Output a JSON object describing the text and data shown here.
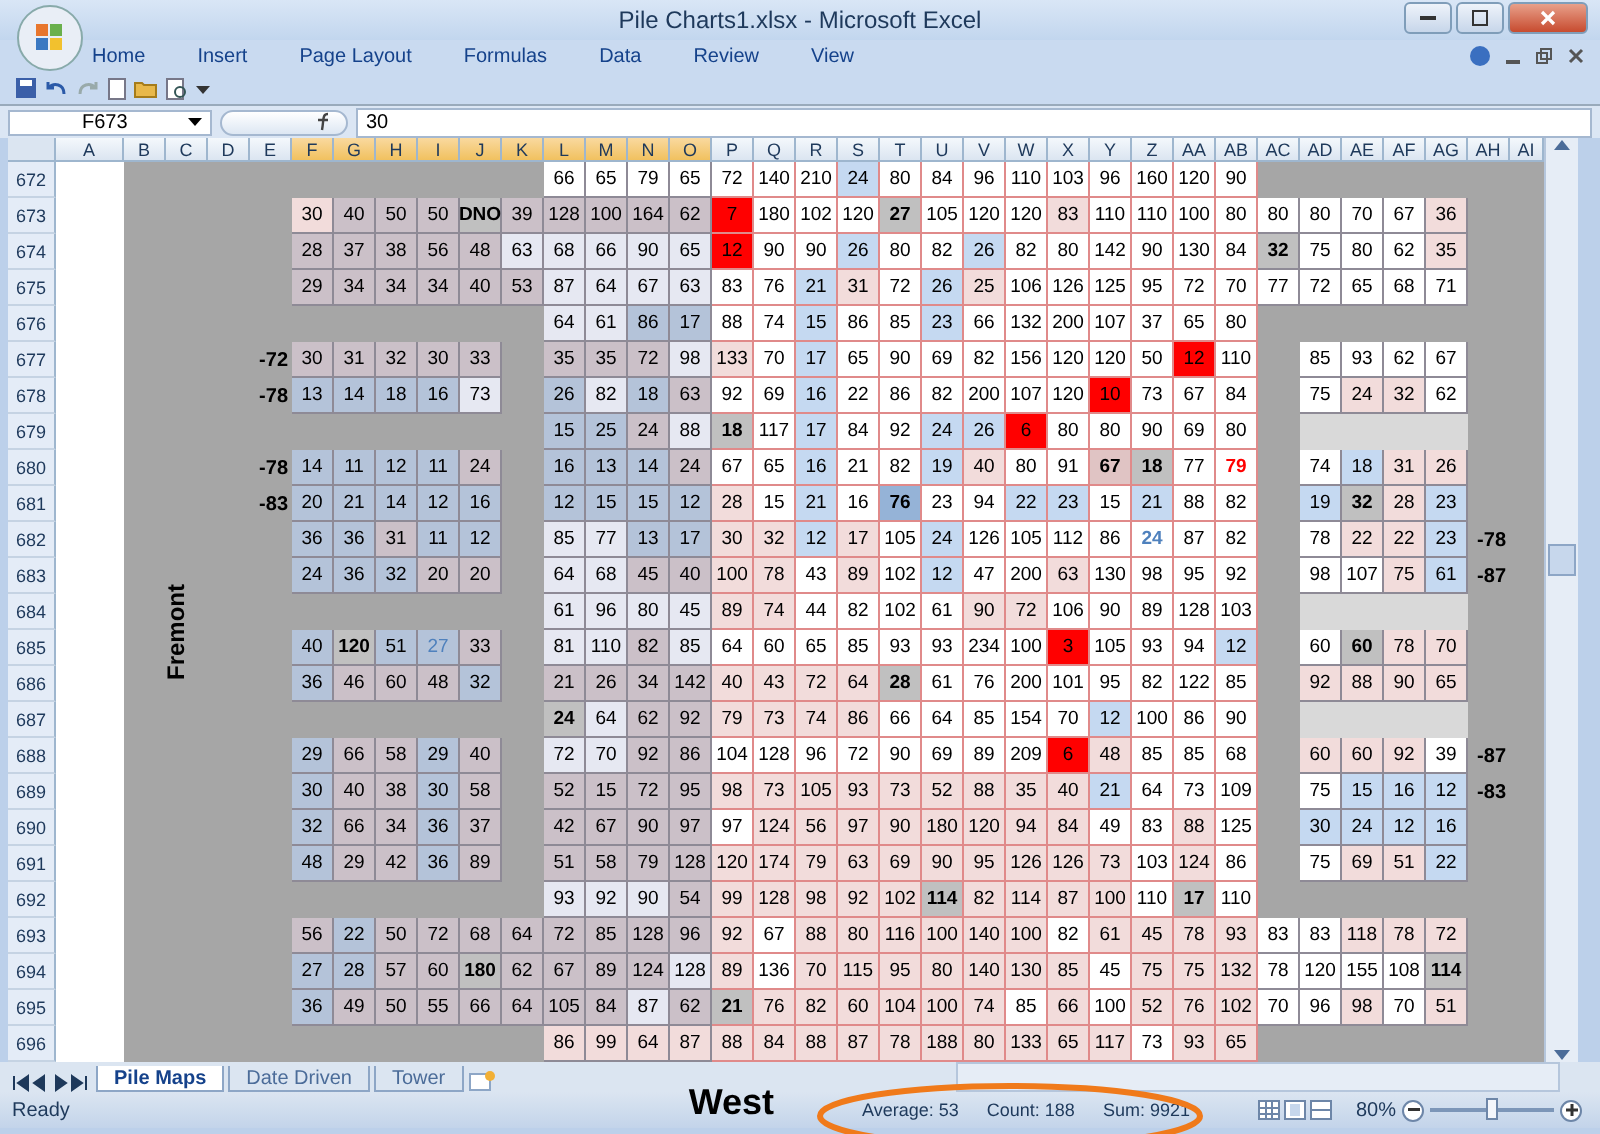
{
  "window": {
    "title": "Pile Charts1.xlsx - Microsoft Excel"
  },
  "ribbon_tabs": [
    "Home",
    "Insert",
    "Page Layout",
    "Formulas",
    "Data",
    "Review",
    "View"
  ],
  "name_box": "F673",
  "formula": "30",
  "columns": [
    {
      "label": "A",
      "selected": false
    },
    {
      "label": "B",
      "selected": false
    },
    {
      "label": "C",
      "selected": false
    },
    {
      "label": "D",
      "selected": false
    },
    {
      "label": "E",
      "selected": false
    },
    {
      "label": "F",
      "selected": true
    },
    {
      "label": "G",
      "selected": true
    },
    {
      "label": "H",
      "selected": true
    },
    {
      "label": "I",
      "selected": true
    },
    {
      "label": "J",
      "selected": true
    },
    {
      "label": "K",
      "selected": true
    },
    {
      "label": "L",
      "selected": true
    },
    {
      "label": "M",
      "selected": true
    },
    {
      "label": "N",
      "selected": true
    },
    {
      "label": "O",
      "selected": true
    },
    {
      "label": "P",
      "selected": false
    },
    {
      "label": "Q",
      "selected": false
    },
    {
      "label": "R",
      "selected": false
    },
    {
      "label": "S",
      "selected": false
    },
    {
      "label": "T",
      "selected": false
    },
    {
      "label": "U",
      "selected": false
    },
    {
      "label": "V",
      "selected": false
    },
    {
      "label": "W",
      "selected": false
    },
    {
      "label": "X",
      "selected": false
    },
    {
      "label": "Y",
      "selected": false
    },
    {
      "label": "Z",
      "selected": false
    },
    {
      "label": "AA",
      "selected": false
    },
    {
      "label": "AB",
      "selected": false
    },
    {
      "label": "AC",
      "selected": false
    },
    {
      "label": "AD",
      "selected": false
    },
    {
      "label": "AE",
      "selected": false
    },
    {
      "label": "AF",
      "selected": false
    },
    {
      "label": "AG",
      "selected": false
    },
    {
      "label": "AH",
      "selected": false
    },
    {
      "label": "AI",
      "selected": false
    }
  ],
  "rows": [
    {
      "number": "672",
      "cells": [
        null,
        null,
        null,
        null,
        null,
        null,
        "66",
        "65",
        "79",
        "65",
        "72",
        "140",
        "210",
        {
          "text": "24",
          "color": "#c5d9f1"
        },
        "80",
        "84",
        "96",
        "110",
        "103",
        "96",
        "160",
        "120",
        "90",
        null,
        null,
        null,
        null,
        null
      ]
    },
    {
      "number": "673",
      "cells": [
        {
          "text": "30",
          "color": "#f2dcdb"
        },
        {
          "text": "40",
          "color": "#cbc0c8"
        },
        {
          "text": "50",
          "color": "#cbc0c8"
        },
        {
          "text": "50",
          "color": "#cbc0c8"
        },
        {
          "text": "DNO",
          "color": "#c0c0c0",
          "bold": true
        },
        {
          "text": "39",
          "color": "#cbc0c8"
        },
        {
          "text": "128",
          "color": "#cbc0c8"
        },
        {
          "text": "100",
          "color": "#cbc0c8"
        },
        {
          "text": "164",
          "color": "#cbc0c8"
        },
        {
          "text": "62",
          "color": "#cbc0c8"
        },
        {
          "text": "7",
          "color": "#ff0000"
        },
        "180",
        "102",
        "120",
        {
          "text": "27",
          "color": "#c0c0c0",
          "bold": true
        },
        "105",
        "120",
        "120",
        {
          "text": "83",
          "color": "#f2dcdb"
        },
        "110",
        "110",
        "100",
        "80",
        "80",
        "80",
        "70",
        "67",
        {
          "text": "36",
          "color": "#f2dcdb"
        }
      ]
    },
    {
      "number": "674",
      "cells": [
        {
          "text": "28",
          "color": "#cbc0c8"
        },
        {
          "text": "37",
          "color": "#cbc0c8"
        },
        {
          "text": "38",
          "color": "#cbc0c8"
        },
        {
          "text": "56",
          "color": "#cbc0c8"
        },
        {
          "text": "48",
          "color": "#cbc0c8"
        },
        {
          "text": "63",
          "color": "#e6e8f2"
        },
        {
          "text": "68",
          "color": "#e6e8f2"
        },
        {
          "text": "66",
          "color": "#e6e8f2"
        },
        {
          "text": "90",
          "color": "#e6e8f2"
        },
        {
          "text": "65",
          "color": "#e6e8f2"
        },
        {
          "text": "12",
          "color": "#ff0000"
        },
        "90",
        "90",
        {
          "text": "26",
          "color": "#c5d9f1"
        },
        "80",
        "82",
        {
          "text": "26",
          "color": "#c5d9f1"
        },
        "82",
        "80",
        "142",
        "90",
        "130",
        "84",
        {
          "text": "32",
          "color": "#c0c0c0",
          "bold": true
        },
        "75",
        "80",
        "62",
        {
          "text": "35",
          "color": "#f2dcdb"
        }
      ]
    },
    {
      "number": "675",
      "cells": [
        {
          "text": "29",
          "color": "#cbc0c8"
        },
        {
          "text": "34",
          "color": "#cbc0c8"
        },
        {
          "text": "34",
          "color": "#cbc0c8"
        },
        {
          "text": "34",
          "color": "#cbc0c8"
        },
        {
          "text": "40",
          "color": "#cbc0c8"
        },
        {
          "text": "53",
          "color": "#cbc0c8"
        },
        {
          "text": "87",
          "color": "#e6e8f2"
        },
        {
          "text": "64",
          "color": "#e6e8f2"
        },
        {
          "text": "67",
          "color": "#e6e8f2"
        },
        {
          "text": "63",
          "color": "#e6e8f2"
        },
        "83",
        "76",
        {
          "text": "21",
          "color": "#c5d9f1"
        },
        {
          "text": "31",
          "color": "#f2dcdb"
        },
        "72",
        {
          "text": "26",
          "color": "#c5d9f1"
        },
        {
          "text": "25",
          "color": "#f2dcdb"
        },
        "106",
        "126",
        "125",
        "95",
        "72",
        "70",
        "77",
        "72",
        "65",
        "68",
        "71"
      ]
    },
    {
      "number": "676",
      "cells": [
        null,
        null,
        null,
        null,
        null,
        null,
        {
          "text": "64",
          "color": "#e6e8f2"
        },
        {
          "text": "61",
          "color": "#e6e8f2"
        },
        {
          "text": "86",
          "color": "#b4c3d9"
        },
        {
          "text": "17",
          "color": "#b4c3d9"
        },
        "88",
        "74",
        {
          "text": "15",
          "color": "#c5d9f1"
        },
        "86",
        "85",
        {
          "text": "23",
          "color": "#c5d9f1"
        },
        "66",
        "132",
        "200",
        "107",
        "37",
        "65",
        "80",
        null,
        null,
        null,
        null,
        null
      ]
    },
    {
      "number": "677",
      "left_label": "-72",
      "cells": [
        {
          "text": "30",
          "color": "#cbc0c8"
        },
        {
          "text": "31",
          "color": "#cbc0c8"
        },
        {
          "text": "32",
          "color": "#cbc0c8"
        },
        {
          "text": "30",
          "color": "#cbc0c8"
        },
        {
          "text": "33",
          "color": "#cbc0c8"
        },
        null,
        {
          "text": "35",
          "color": "#cbc0c8"
        },
        {
          "text": "35",
          "color": "#cbc0c8"
        },
        {
          "text": "72",
          "color": "#cbc0c8"
        },
        {
          "text": "98",
          "color": "#e6e8f2"
        },
        {
          "text": "133",
          "color": "#f2dcdb"
        },
        "70",
        {
          "text": "17",
          "color": "#c5d9f1"
        },
        "65",
        "90",
        "69",
        "82",
        "156",
        "120",
        "120",
        "50",
        {
          "text": "12",
          "color": "#ff0000"
        },
        "110",
        null,
        "85",
        "93",
        "62",
        "67"
      ]
    },
    {
      "number": "678",
      "left_label": "-78",
      "cells": [
        {
          "text": "13",
          "color": "#b4c3d9"
        },
        {
          "text": "14",
          "color": "#b4c3d9"
        },
        {
          "text": "18",
          "color": "#b4c3d9"
        },
        {
          "text": "16",
          "color": "#b4c3d9"
        },
        {
          "text": "73",
          "color": "#e6e8f2"
        },
        null,
        {
          "text": "26",
          "color": "#b4c3d9"
        },
        {
          "text": "82",
          "color": "#e6e8f2"
        },
        {
          "text": "18",
          "color": "#b4c3d9"
        },
        {
          "text": "63",
          "color": "#cbc0c8"
        },
        "92",
        "69",
        {
          "text": "16",
          "color": "#c5d9f1"
        },
        "22",
        "86",
        "82",
        "200",
        "107",
        "120",
        {
          "text": "10",
          "color": "#ff0000"
        },
        "73",
        "67",
        "84",
        null,
        "75",
        {
          "text": "24",
          "color": "#f2dcdb"
        },
        {
          "text": "32",
          "color": "#f2dcdb"
        },
        "62"
      ]
    },
    {
      "number": "679",
      "cells": [
        null,
        null,
        null,
        null,
        null,
        null,
        {
          "text": "15",
          "color": "#b4c3d9"
        },
        {
          "text": "25",
          "color": "#b4c3d9"
        },
        {
          "text": "24",
          "color": "#cbc0c8"
        },
        {
          "text": "88",
          "color": "#e6e8f2"
        },
        {
          "text": "18",
          "color": "#c0c0c0",
          "bold": true
        },
        "117",
        {
          "text": "17",
          "color": "#c5d9f1"
        },
        "84",
        "92",
        {
          "text": "24",
          "color": "#c5d9f1"
        },
        {
          "text": "26",
          "color": "#c5d9f1"
        },
        {
          "text": "6",
          "color": "#ff0000"
        },
        "80",
        "80",
        "90",
        "69",
        "80",
        null,
        {
          "color": "#d9d9d9"
        },
        {
          "color": "#d9d9d9"
        },
        {
          "color": "#d9d9d9"
        },
        {
          "color": "#d9d9d9"
        }
      ]
    },
    {
      "number": "680",
      "left_label": "-78",
      "cells": [
        {
          "text": "14",
          "color": "#b4c3d9"
        },
        {
          "text": "11",
          "color": "#b4c3d9"
        },
        {
          "text": "12",
          "color": "#b4c3d9"
        },
        {
          "text": "11",
          "color": "#b4c3d9"
        },
        {
          "text": "24",
          "color": "#cbc0c8"
        },
        null,
        {
          "text": "16",
          "color": "#b4c3d9"
        },
        {
          "text": "13",
          "color": "#b4c3d9"
        },
        {
          "text": "14",
          "color": "#b4c3d9"
        },
        {
          "text": "24",
          "color": "#cbc0c8"
        },
        "67",
        "65",
        {
          "text": "16",
          "color": "#c5d9f1"
        },
        "21",
        "82",
        {
          "text": "19",
          "color": "#c5d9f1"
        },
        {
          "text": "40",
          "color": "#f2dcdb"
        },
        "80",
        "91",
        {
          "text": "67",
          "color": "#e0c4c4",
          "bold": true
        },
        {
          "text": "18",
          "color": "#c0c0c0",
          "bold": true
        },
        "77",
        {
          "text": "79",
          "color": "#ffffff",
          "bold": true,
          "kind": "warning"
        },
        null,
        "74",
        {
          "text": "18",
          "color": "#c5d9f1"
        },
        {
          "text": "31",
          "color": "#f2dcdb"
        },
        {
          "text": "26",
          "color": "#f2dcdb"
        }
      ]
    },
    {
      "number": "681",
      "left_label": "-83",
      "cells": [
        {
          "text": "20",
          "color": "#b4c3d9"
        },
        {
          "text": "21",
          "color": "#b4c3d9"
        },
        {
          "text": "14",
          "color": "#b4c3d9"
        },
        {
          "text": "12",
          "color": "#b4c3d9"
        },
        {
          "text": "16",
          "color": "#b4c3d9"
        },
        null,
        {
          "text": "12",
          "color": "#b4c3d9"
        },
        {
          "text": "15",
          "color": "#b4c3d9"
        },
        {
          "text": "15",
          "color": "#b4c3d9"
        },
        {
          "text": "12",
          "color": "#b4c3d9"
        },
        {
          "text": "28",
          "color": "#f2dcdb"
        },
        "15",
        {
          "text": "21",
          "color": "#c5d9f1"
        },
        "16",
        {
          "text": "76",
          "color": "#95b3d7",
          "bold": true
        },
        "23",
        "94",
        {
          "text": "22",
          "color": "#c5d9f1"
        },
        {
          "text": "23",
          "color": "#c5d9f1"
        },
        "15",
        {
          "text": "21",
          "color": "#c5d9f1"
        },
        "88",
        "82",
        null,
        {
          "text": "19",
          "color": "#c5d9f1"
        },
        {
          "text": "32",
          "color": "#c0c0c0",
          "bold": true
        },
        {
          "text": "28",
          "color": "#f2dcdb"
        },
        {
          "text": "23",
          "color": "#c5d9f1"
        }
      ]
    },
    {
      "number": "682",
      "right_label": "-78",
      "cells": [
        {
          "text": "36",
          "color": "#b4c3d9"
        },
        {
          "text": "36",
          "color": "#b4c3d9"
        },
        {
          "text": "31",
          "color": "#cbc0c8"
        },
        {
          "text": "11",
          "color": "#b4c3d9"
        },
        {
          "text": "12",
          "color": "#b4c3d9"
        },
        null,
        {
          "text": "85",
          "color": "#e6e8f2"
        },
        {
          "text": "77",
          "color": "#e6e8f2"
        },
        {
          "text": "13",
          "color": "#b4c3d9"
        },
        {
          "text": "17",
          "color": "#b4c3d9"
        },
        {
          "text": "30",
          "color": "#f2dcdb"
        },
        {
          "text": "32",
          "color": "#f2dcdb"
        },
        {
          "text": "12",
          "color": "#c5d9f1"
        },
        {
          "text": "17",
          "color": "#f2dcdb"
        },
        "105",
        {
          "text": "24",
          "color": "#c5d9f1"
        },
        "126",
        "105",
        "112",
        "86",
        {
          "text": "24",
          "color": "#ffffff",
          "bold": true,
          "kind": "note"
        },
        "87",
        "82",
        null,
        "78",
        {
          "text": "22",
          "color": "#f2dcdb"
        },
        {
          "text": "22",
          "color": "#f2dcdb"
        },
        {
          "text": "23",
          "color": "#c5d9f1"
        }
      ]
    },
    {
      "number": "683",
      "right_label": "-87",
      "cells": [
        {
          "text": "24",
          "color": "#b4c3d9"
        },
        {
          "text": "36",
          "color": "#b4c3d9"
        },
        {
          "text": "32",
          "color": "#b4c3d9"
        },
        {
          "text": "20",
          "color": "#cbc0c8"
        },
        {
          "text": "20",
          "color": "#cbc0c8"
        },
        null,
        {
          "text": "64",
          "color": "#e6e8f2"
        },
        {
          "text": "68",
          "color": "#e6e8f2"
        },
        {
          "text": "45",
          "color": "#cbc0c8"
        },
        {
          "text": "40",
          "color": "#cbc0c8"
        },
        {
          "text": "100",
          "color": "#f2dcdb"
        },
        {
          "text": "78",
          "color": "#f2dcdb"
        },
        "43",
        {
          "text": "89",
          "color": "#f2dcdb"
        },
        "102",
        {
          "text": "12",
          "color": "#c5d9f1"
        },
        "47",
        "200",
        {
          "text": "63",
          "color": "#f2dcdb"
        },
        "130",
        "98",
        "95",
        "92",
        null,
        "98",
        "107",
        {
          "text": "75",
          "color": "#f2dcdb"
        },
        {
          "text": "61",
          "color": "#c5d9f1"
        }
      ]
    },
    {
      "number": "684",
      "cells": [
        null,
        null,
        null,
        null,
        null,
        null,
        {
          "text": "61",
          "color": "#e6e8f2"
        },
        {
          "text": "96",
          "color": "#e6e8f2"
        },
        {
          "text": "80",
          "color": "#e6e8f2"
        },
        {
          "text": "45",
          "color": "#e6e8f2"
        },
        {
          "text": "89",
          "color": "#f2dcdb"
        },
        {
          "text": "74",
          "color": "#f2dcdb"
        },
        "44",
        "82",
        "102",
        "61",
        {
          "text": "90",
          "color": "#f2dcdb"
        },
        {
          "text": "72",
          "color": "#f2dcdb"
        },
        "106",
        "90",
        "89",
        "128",
        "103",
        null,
        {
          "color": "#d9d9d9"
        },
        {
          "color": "#d9d9d9"
        },
        {
          "color": "#d9d9d9"
        },
        {
          "color": "#d9d9d9"
        }
      ]
    },
    {
      "number": "685",
      "cells": [
        {
          "text": "40",
          "color": "#b4c3d9"
        },
        {
          "text": "120",
          "color": "#c0c0c0",
          "bold": true
        },
        {
          "text": "51",
          "color": "#b4c3d9"
        },
        {
          "text": "27",
          "color": "#b4c3d9",
          "kind": "note"
        },
        {
          "text": "33",
          "color": "#cbc0c8"
        },
        null,
        {
          "text": "81",
          "color": "#e6e8f2"
        },
        {
          "text": "110",
          "color": "#e6e8f2"
        },
        {
          "text": "82",
          "color": "#cbc0c8"
        },
        {
          "text": "85",
          "color": "#e6e8f2"
        },
        "64",
        "60",
        "65",
        "85",
        "93",
        "93",
        "234",
        "100",
        {
          "text": "3",
          "color": "#ff0000"
        },
        "105",
        "93",
        "94",
        {
          "text": "12",
          "color": "#c5d9f1"
        },
        null,
        "60",
        {
          "text": "60",
          "color": "#c0c0c0",
          "bold": true
        },
        {
          "text": "78",
          "color": "#f2dcdb"
        },
        {
          "text": "70",
          "color": "#f2dcdb"
        }
      ]
    },
    {
      "number": "686",
      "cells": [
        {
          "text": "36",
          "color": "#b4c3d9"
        },
        {
          "text": "46",
          "color": "#cbc0c8"
        },
        {
          "text": "60",
          "color": "#cbc0c8"
        },
        {
          "text": "48",
          "color": "#cbc0c8"
        },
        {
          "text": "32",
          "color": "#b4c3d9"
        },
        null,
        {
          "text": "21",
          "color": "#cbc0c8"
        },
        {
          "text": "26",
          "color": "#cbc0c8"
        },
        {
          "text": "34",
          "color": "#cbc0c8"
        },
        {
          "text": "142",
          "color": "#cbc0c8"
        },
        {
          "text": "40",
          "color": "#f2dcdb"
        },
        {
          "text": "43",
          "color": "#f2dcdb"
        },
        {
          "text": "72",
          "color": "#f2dcdb"
        },
        {
          "text": "64",
          "color": "#f2dcdb"
        },
        {
          "text": "28",
          "color": "#c0c0c0",
          "bold": true
        },
        "61",
        "76",
        "200",
        "101",
        "95",
        "82",
        "122",
        "85",
        null,
        {
          "text": "92",
          "color": "#f2dcdb"
        },
        {
          "text": "88",
          "color": "#f2dcdb"
        },
        {
          "text": "90",
          "color": "#f2dcdb"
        },
        {
          "text": "65",
          "color": "#f2dcdb"
        }
      ]
    },
    {
      "number": "687",
      "cells": [
        null,
        null,
        null,
        null,
        null,
        null,
        {
          "text": "24",
          "color": "#c0c0c0",
          "bold": true
        },
        {
          "text": "64",
          "color": "#e6e8f2"
        },
        {
          "text": "62",
          "color": "#cbc0c8"
        },
        {
          "text": "92",
          "color": "#cbc0c8"
        },
        {
          "text": "79",
          "color": "#f2dcdb"
        },
        {
          "text": "73",
          "color": "#f2dcdb"
        },
        {
          "text": "74",
          "color": "#f2dcdb"
        },
        {
          "text": "86",
          "color": "#f2dcdb"
        },
        "66",
        "64",
        "85",
        "154",
        "70",
        {
          "text": "12",
          "color": "#c5d9f1"
        },
        "100",
        "86",
        "90",
        null,
        {
          "color": "#d9d9d9"
        },
        {
          "color": "#d9d9d9"
        },
        {
          "color": "#d9d9d9"
        },
        {
          "color": "#d9d9d9"
        }
      ]
    },
    {
      "number": "688",
      "right_label": "-87",
      "cells": [
        {
          "text": "29",
          "color": "#b4c3d9"
        },
        {
          "text": "66",
          "color": "#cbc0c8"
        },
        {
          "text": "58",
          "color": "#cbc0c8"
        },
        {
          "text": "29",
          "color": "#b4c3d9"
        },
        {
          "text": "40",
          "color": "#cbc0c8"
        },
        null,
        {
          "text": "72",
          "color": "#e6e8f2"
        },
        {
          "text": "70",
          "color": "#e6e8f2"
        },
        {
          "text": "92",
          "color": "#cbc0c8"
        },
        {
          "text": "86",
          "color": "#cbc0c8"
        },
        "104",
        "128",
        "96",
        "72",
        "90",
        "69",
        "89",
        "209",
        {
          "text": "6",
          "color": "#ff0000"
        },
        {
          "text": "48",
          "color": "#f2dcdb"
        },
        "85",
        "85",
        "68",
        null,
        {
          "text": "60",
          "color": "#f2dcdb"
        },
        {
          "text": "60",
          "color": "#f2dcdb"
        },
        {
          "text": "92",
          "color": "#f2dcdb"
        },
        "39"
      ]
    },
    {
      "number": "689",
      "right_label": "-83",
      "cells": [
        {
          "text": "30",
          "color": "#b4c3d9"
        },
        {
          "text": "40",
          "color": "#cbc0c8"
        },
        {
          "text": "38",
          "color": "#cbc0c8"
        },
        {
          "text": "30",
          "color": "#b4c3d9"
        },
        {
          "text": "58",
          "color": "#cbc0c8"
        },
        null,
        {
          "text": "52",
          "color": "#cbc0c8"
        },
        {
          "text": "15",
          "color": "#cbc0c8"
        },
        {
          "text": "72",
          "color": "#cbc0c8"
        },
        {
          "text": "95",
          "color": "#cbc0c8"
        },
        {
          "text": "98",
          "color": "#f2dcdb"
        },
        {
          "text": "73",
          "color": "#f2dcdb"
        },
        {
          "text": "105",
          "color": "#f2dcdb"
        },
        {
          "text": "93",
          "color": "#f2dcdb"
        },
        {
          "text": "73",
          "color": "#f2dcdb"
        },
        {
          "text": "52",
          "color": "#f2dcdb"
        },
        {
          "text": "88",
          "color": "#f2dcdb"
        },
        {
          "text": "35",
          "color": "#f2dcdb"
        },
        {
          "text": "40",
          "color": "#f2dcdb"
        },
        {
          "text": "21",
          "color": "#c5d9f1"
        },
        "64",
        "73",
        "109",
        null,
        "75",
        {
          "text": "15",
          "color": "#c5d9f1"
        },
        {
          "text": "16",
          "color": "#c5d9f1"
        },
        {
          "text": "12",
          "color": "#c5d9f1"
        }
      ]
    },
    {
      "number": "690",
      "cells": [
        {
          "text": "32",
          "color": "#b4c3d9"
        },
        {
          "text": "66",
          "color": "#cbc0c8"
        },
        {
          "text": "34",
          "color": "#cbc0c8"
        },
        {
          "text": "36",
          "color": "#b4c3d9"
        },
        {
          "text": "37",
          "color": "#cbc0c8"
        },
        null,
        {
          "text": "42",
          "color": "#cbc0c8"
        },
        {
          "text": "67",
          "color": "#cbc0c8"
        },
        {
          "text": "90",
          "color": "#cbc0c8"
        },
        {
          "text": "97",
          "color": "#cbc0c8"
        },
        "97",
        {
          "text": "124",
          "color": "#f2dcdb"
        },
        {
          "text": "56",
          "color": "#f2dcdb"
        },
        {
          "text": "97",
          "color": "#f2dcdb"
        },
        {
          "text": "90",
          "color": "#f2dcdb"
        },
        {
          "text": "180",
          "color": "#f2dcdb"
        },
        {
          "text": "120",
          "color": "#f2dcdb"
        },
        {
          "text": "94",
          "color": "#f2dcdb"
        },
        {
          "text": "84",
          "color": "#f2dcdb"
        },
        "49",
        "83",
        {
          "text": "88",
          "color": "#f2dcdb"
        },
        "125",
        null,
        {
          "text": "30",
          "color": "#c5d9f1"
        },
        {
          "text": "24",
          "color": "#c5d9f1"
        },
        {
          "text": "12",
          "color": "#c5d9f1"
        },
        {
          "text": "16",
          "color": "#c5d9f1"
        }
      ]
    },
    {
      "number": "691",
      "cells": [
        {
          "text": "48",
          "color": "#b4c3d9"
        },
        {
          "text": "29",
          "color": "#cbc0c8"
        },
        {
          "text": "42",
          "color": "#cbc0c8"
        },
        {
          "text": "36",
          "color": "#b4c3d9"
        },
        {
          "text": "89",
          "color": "#cbc0c8"
        },
        null,
        {
          "text": "51",
          "color": "#cbc0c8"
        },
        {
          "text": "58",
          "color": "#cbc0c8"
        },
        {
          "text": "79",
          "color": "#cbc0c8"
        },
        {
          "text": "128",
          "color": "#cbc0c8"
        },
        {
          "text": "120",
          "color": "#f2dcdb"
        },
        {
          "text": "174",
          "color": "#f2dcdb"
        },
        {
          "text": "79",
          "color": "#f2dcdb"
        },
        {
          "text": "63",
          "color": "#f2dcdb"
        },
        {
          "text": "69",
          "color": "#f2dcdb"
        },
        {
          "text": "90",
          "color": "#f2dcdb"
        },
        {
          "text": "95",
          "color": "#f2dcdb"
        },
        {
          "text": "126",
          "color": "#f2dcdb"
        },
        {
          "text": "126",
          "color": "#f2dcdb"
        },
        {
          "text": "73",
          "color": "#f2dcdb"
        },
        "103",
        {
          "text": "124",
          "color": "#f2dcdb"
        },
        "86",
        null,
        "75",
        {
          "text": "69",
          "color": "#f2dcdb"
        },
        {
          "text": "51",
          "color": "#f2dcdb"
        },
        {
          "text": "22",
          "color": "#c5d9f1"
        }
      ]
    },
    {
      "number": "692",
      "cells": [
        null,
        null,
        null,
        null,
        null,
        null,
        {
          "text": "93",
          "color": "#e6e8f2"
        },
        {
          "text": "92",
          "color": "#e6e8f2"
        },
        {
          "text": "90",
          "color": "#e6e8f2"
        },
        {
          "text": "54",
          "color": "#cbc0c8"
        },
        {
          "text": "99",
          "color": "#f2dcdb"
        },
        {
          "text": "128",
          "color": "#f2dcdb"
        },
        {
          "text": "98",
          "color": "#f2dcdb"
        },
        {
          "text": "92",
          "color": "#f2dcdb"
        },
        {
          "text": "102",
          "color": "#f2dcdb"
        },
        {
          "text": "114",
          "color": "#c0c0c0",
          "bold": true
        },
        {
          "text": "82",
          "color": "#f2dcdb"
        },
        {
          "text": "114",
          "color": "#f2dcdb"
        },
        {
          "text": "87",
          "color": "#f2dcdb"
        },
        {
          "text": "100",
          "color": "#f2dcdb"
        },
        "110",
        {
          "text": "17",
          "color": "#c0c0c0",
          "bold": true
        },
        "110",
        null,
        null,
        null,
        null,
        null
      ]
    },
    {
      "number": "693",
      "cells": [
        {
          "text": "56",
          "color": "#cbc0c8"
        },
        {
          "text": "22",
          "color": "#b4c3d9"
        },
        {
          "text": "50",
          "color": "#cbc0c8"
        },
        {
          "text": "72",
          "color": "#cbc0c8"
        },
        {
          "text": "68",
          "color": "#cbc0c8"
        },
        {
          "text": "64",
          "color": "#cbc0c8"
        },
        {
          "text": "72",
          "color": "#cbc0c8"
        },
        {
          "text": "85",
          "color": "#cbc0c8"
        },
        {
          "text": "128",
          "color": "#cbc0c8"
        },
        {
          "text": "96",
          "color": "#cbc0c8"
        },
        {
          "text": "92",
          "color": "#f2dcdb"
        },
        "67",
        {
          "text": "88",
          "color": "#f2dcdb"
        },
        {
          "text": "80",
          "color": "#f2dcdb"
        },
        {
          "text": "116",
          "color": "#f2dcdb"
        },
        {
          "text": "100",
          "color": "#f2dcdb"
        },
        {
          "text": "140",
          "color": "#f2dcdb"
        },
        {
          "text": "100",
          "color": "#f2dcdb"
        },
        "82",
        {
          "text": "61",
          "color": "#f2dcdb"
        },
        {
          "text": "45",
          "color": "#f2dcdb"
        },
        {
          "text": "78",
          "color": "#f2dcdb"
        },
        {
          "text": "93",
          "color": "#f2dcdb"
        },
        "83",
        "83",
        {
          "text": "118",
          "color": "#f2dcdb"
        },
        {
          "text": "78",
          "color": "#f2dcdb"
        },
        {
          "text": "72",
          "color": "#f2dcdb"
        }
      ]
    },
    {
      "number": "694",
      "cells": [
        {
          "text": "27",
          "color": "#b4c3d9"
        },
        {
          "text": "28",
          "color": "#b4c3d9"
        },
        {
          "text": "57",
          "color": "#cbc0c8"
        },
        {
          "text": "60",
          "color": "#cbc0c8"
        },
        {
          "text": "180",
          "color": "#c0c0c0",
          "bold": true
        },
        {
          "text": "62",
          "color": "#cbc0c8"
        },
        {
          "text": "67",
          "color": "#cbc0c8"
        },
        {
          "text": "89",
          "color": "#cbc0c8"
        },
        {
          "text": "124",
          "color": "#cbc0c8"
        },
        {
          "text": "128",
          "color": "#e6e8f2"
        },
        {
          "text": "89",
          "color": "#f2dcdb"
        },
        "136",
        {
          "text": "70",
          "color": "#f2dcdb"
        },
        {
          "text": "115",
          "color": "#f2dcdb"
        },
        {
          "text": "95",
          "color": "#f2dcdb"
        },
        {
          "text": "80",
          "color": "#f2dcdb"
        },
        {
          "text": "140",
          "color": "#f2dcdb"
        },
        {
          "text": "130",
          "color": "#f2dcdb"
        },
        {
          "text": "85",
          "color": "#f2dcdb"
        },
        "45",
        {
          "text": "75",
          "color": "#f2dcdb"
        },
        {
          "text": "75",
          "color": "#f2dcdb"
        },
        {
          "text": "132",
          "color": "#f2dcdb"
        },
        "78",
        "120",
        "155",
        "108",
        {
          "text": "114",
          "color": "#c0c0c0",
          "bold": true
        }
      ]
    },
    {
      "number": "695",
      "cells": [
        {
          "text": "36",
          "color": "#b4c3d9"
        },
        {
          "text": "49",
          "color": "#cbc0c8"
        },
        {
          "text": "50",
          "color": "#cbc0c8"
        },
        {
          "text": "55",
          "color": "#cbc0c8"
        },
        {
          "text": "66",
          "color": "#cbc0c8"
        },
        {
          "text": "64",
          "color": "#cbc0c8"
        },
        {
          "text": "105",
          "color": "#cbc0c8"
        },
        {
          "text": "84",
          "color": "#cbc0c8"
        },
        {
          "text": "87",
          "color": "#e6e8f2"
        },
        {
          "text": "62",
          "color": "#cbc0c8"
        },
        {
          "text": "21",
          "color": "#c0c0c0",
          "bold": true
        },
        {
          "text": "76",
          "color": "#f2dcdb"
        },
        {
          "text": "82",
          "color": "#f2dcdb"
        },
        {
          "text": "60",
          "color": "#f2dcdb"
        },
        {
          "text": "104",
          "color": "#f2dcdb"
        },
        {
          "text": "100",
          "color": "#f2dcdb"
        },
        {
          "text": "74",
          "color": "#f2dcdb"
        },
        "85",
        {
          "text": "66",
          "color": "#f2dcdb"
        },
        "100",
        {
          "text": "52",
          "color": "#f2dcdb"
        },
        {
          "text": "76",
          "color": "#f2dcdb"
        },
        {
          "text": "102",
          "color": "#f2dcdb"
        },
        "70",
        "96",
        {
          "text": "98",
          "color": "#f2dcdb"
        },
        "70",
        {
          "text": "51",
          "color": "#f2dcdb"
        }
      ]
    },
    {
      "number": "696",
      "cells": [
        null,
        null,
        null,
        null,
        null,
        null,
        {
          "text": "86",
          "color": "#f2dcdb"
        },
        {
          "text": "99",
          "color": "#f2dcdb"
        },
        {
          "text": "64",
          "color": "#f2dcdb"
        },
        {
          "text": "87",
          "color": "#f2dcdb"
        },
        {
          "text": "88",
          "color": "#f2dcdb"
        },
        {
          "text": "84",
          "color": "#f2dcdb"
        },
        {
          "text": "88",
          "color": "#f2dcdb"
        },
        {
          "text": "87",
          "color": "#f2dcdb"
        },
        {
          "text": "78",
          "color": "#f2dcdb"
        },
        {
          "text": "188",
          "color": "#f2dcdb"
        },
        {
          "text": "80",
          "color": "#f2dcdb"
        },
        {
          "text": "133",
          "color": "#f2dcdb"
        },
        {
          "text": "65",
          "color": "#f2dcdb"
        },
        {
          "text": "117",
          "color": "#f2dcdb"
        },
        "73",
        {
          "text": "93",
          "color": "#f2dcdb"
        },
        {
          "text": "65",
          "color": "#f2dcdb"
        },
        null,
        null,
        null,
        null,
        null
      ]
    }
  ],
  "sheet_label": "Fremont",
  "sheet_tabs": [
    {
      "label": "Pile Maps",
      "selected": true
    },
    {
      "label": "Date Driven",
      "selected": false
    },
    {
      "label": "Tower",
      "selected": false
    }
  ],
  "status_bar": {
    "status": "Ready",
    "overlay_text": "West",
    "stats": [
      "Average: 53",
      "Count: 188",
      "Sum: 9921"
    ],
    "zoom": "80%",
    "zoom_slider": {
      "level": 0.5
    }
  }
}
